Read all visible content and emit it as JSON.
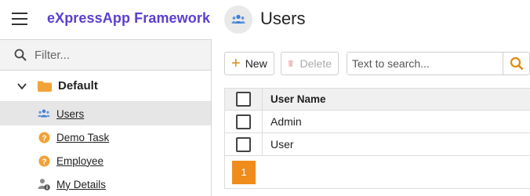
{
  "header": {
    "app_title": "eXpressApp Framework",
    "view_title": "Users",
    "menu_icon": "hamburger-icon",
    "view_icon": "users-icon"
  },
  "sidebar": {
    "filter_placeholder": "Filter...",
    "group": {
      "label": "Default",
      "icon": "folder-icon",
      "expanded": true
    },
    "items": [
      {
        "label": "Users",
        "icon": "users-icon",
        "active": true
      },
      {
        "label": "Demo Task",
        "icon": "question-badge-icon",
        "active": false
      },
      {
        "label": "Employee",
        "icon": "question-badge-icon",
        "active": false
      },
      {
        "label": "My Details",
        "icon": "user-info-icon",
        "active": false
      }
    ]
  },
  "toolbar": {
    "new_label": "New",
    "delete_label": "Delete",
    "search_placeholder": "Text to search..."
  },
  "grid": {
    "columns": [
      "User Name"
    ],
    "rows": [
      {
        "user_name": "Admin"
      },
      {
        "user_name": "User"
      }
    ]
  },
  "pager": {
    "current_page": "1"
  },
  "colors": {
    "accent": "#f08c1c",
    "brand": "#5b3fd0",
    "user_icon_blue": "#3b7fd4"
  }
}
